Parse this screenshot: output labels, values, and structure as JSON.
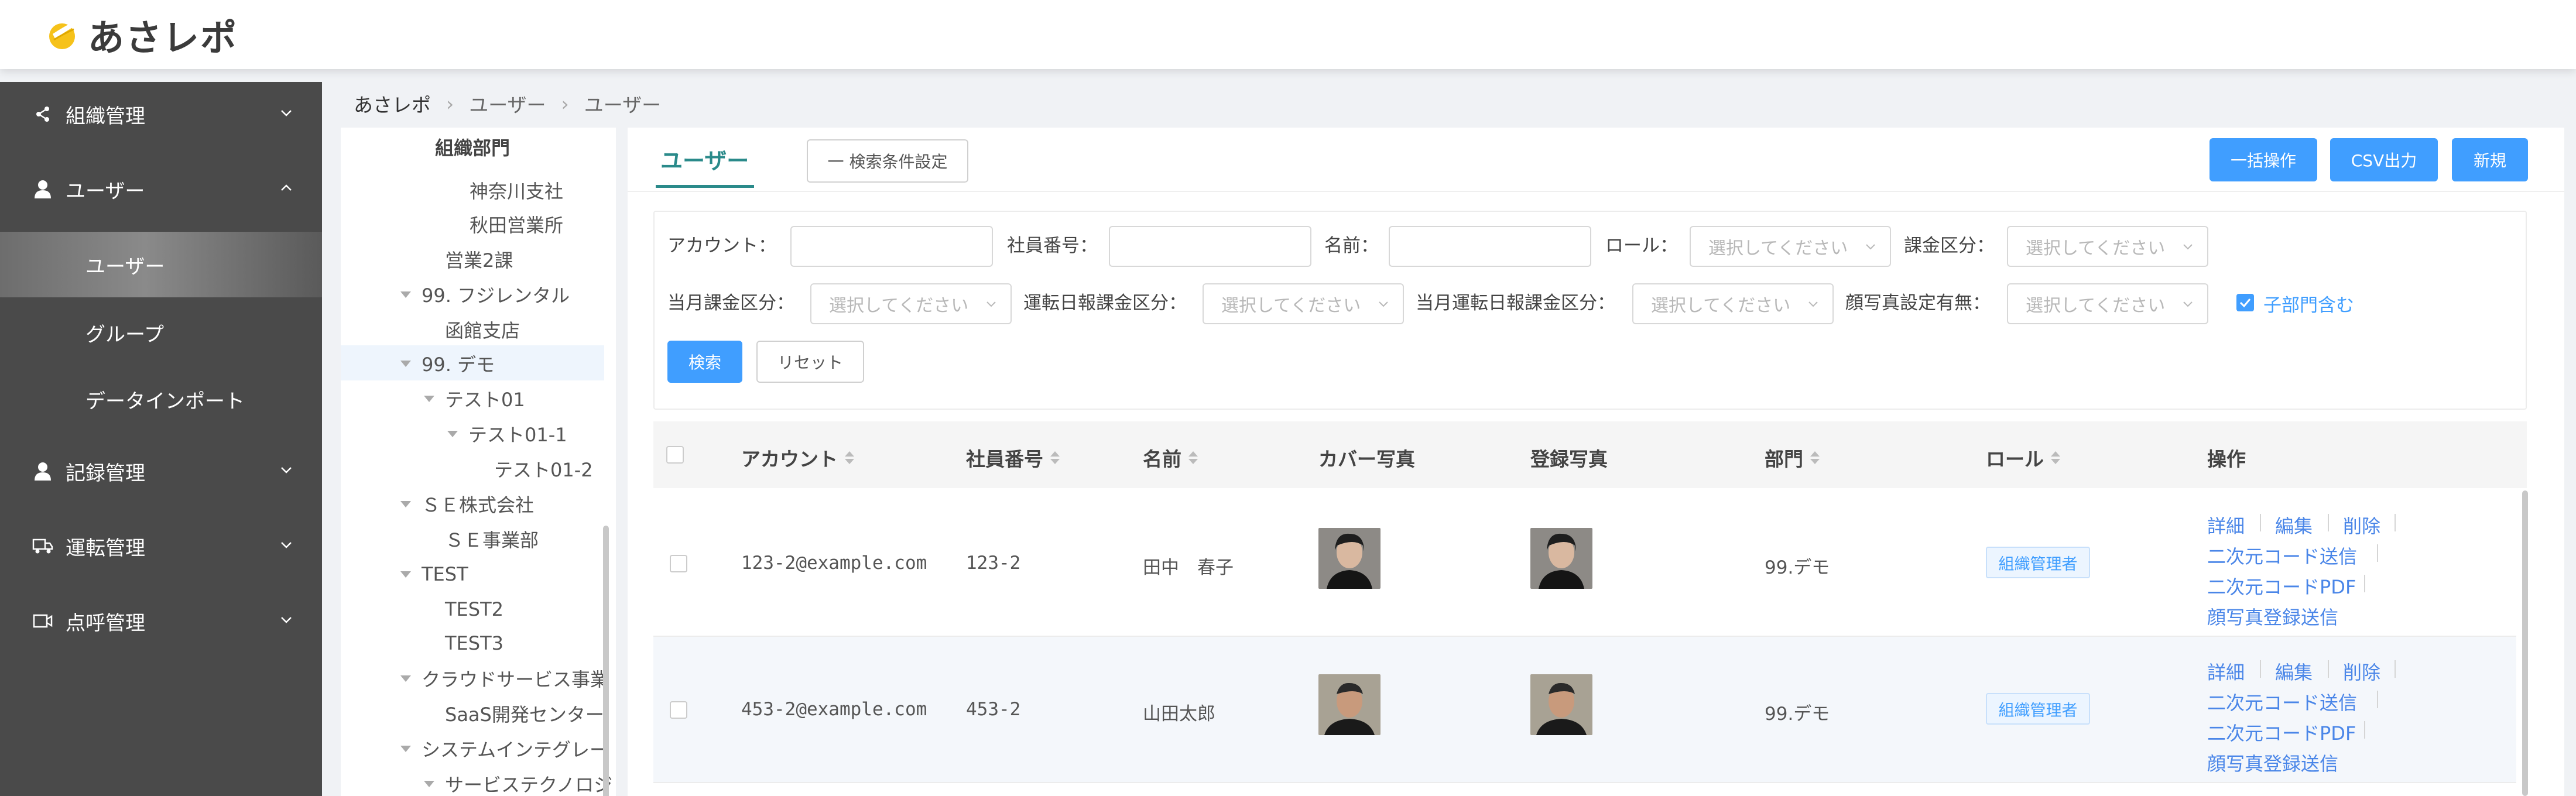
{
  "app": {
    "logo_text": "あさレポ"
  },
  "sidebar": {
    "groups": [
      {
        "label": "組織管理",
        "icon": "share-icon",
        "expanded": false
      },
      {
        "label": "ユーザー",
        "icon": "user-icon",
        "expanded": true
      },
      {
        "label": "記録管理",
        "icon": "user-icon",
        "expanded": false
      },
      {
        "label": "運転管理",
        "icon": "truck-icon",
        "expanded": false
      },
      {
        "label": "点呼管理",
        "icon": "camera-icon",
        "expanded": false
      }
    ],
    "sub_items": [
      {
        "label": "ユーザー",
        "active": true
      },
      {
        "label": "グループ",
        "active": false
      },
      {
        "label": "データインポート",
        "active": false
      }
    ]
  },
  "breadcrumb": [
    "あさレポ",
    "ユーザー",
    "ユーザー"
  ],
  "tree": {
    "title": "組織部門",
    "items": [
      {
        "label": "神奈川支社"
      },
      {
        "label": "秋田営業所"
      },
      {
        "label": "営業2課"
      },
      {
        "label": "99. フジレンタル"
      },
      {
        "label": "函館支店"
      },
      {
        "label": "99. デモ",
        "selected": true
      },
      {
        "label": "テスト01"
      },
      {
        "label": "テスト01-1"
      },
      {
        "label": "テスト01-2"
      },
      {
        "label": "ＳＥ株式会社"
      },
      {
        "label": "ＳＥ事業部"
      },
      {
        "label": "TEST"
      },
      {
        "label": "TEST2"
      },
      {
        "label": "TEST3"
      },
      {
        "label": "クラウドサービス事業"
      },
      {
        "label": "SaaS開発センター"
      },
      {
        "label": "システムインテグレー"
      },
      {
        "label": "サービステクノロジ"
      }
    ]
  },
  "tabs": {
    "active": "ユーザー"
  },
  "toolbar": {
    "search_settings": "一 検索条件設定",
    "bulk": "一括操作",
    "csv": "CSV出力",
    "new": "新規"
  },
  "filters": {
    "account": "アカウント：",
    "employee_no": "社員番号：",
    "name": "名前：",
    "role": "ロール：",
    "billing": "課金区分：",
    "month_billing": "当月課金区分：",
    "drive_report_billing": "運転日報課金区分：",
    "month_drive_report_billing": "当月運転日報課金区分：",
    "face_photo": "顔写真設定有無：",
    "include_sub": "子部門含む",
    "include_sub_checked": true,
    "select_placeholder": "選択してください",
    "search": "検索",
    "reset": "リセット"
  },
  "table": {
    "headers": {
      "account": "アカウント",
      "employee_no": "社員番号",
      "name": "名前",
      "cover": "カバー写真",
      "registered": "登録写真",
      "dept": "部門",
      "role": "ロール",
      "ops": "操作"
    },
    "rows": [
      {
        "account": "123-2@example.com",
        "employee_no": "123-2",
        "name": "田中　春子",
        "dept": "99.デモ",
        "role": "組織管理者"
      },
      {
        "account": "453-2@example.com",
        "employee_no": "453-2",
        "name": "山田太郎",
        "dept": "99.デモ",
        "role": "組織管理者"
      }
    ],
    "ops": {
      "detail": "詳細",
      "edit": "編集",
      "delete": "削除",
      "qr_send": "二次元コード送信",
      "qr_pdf": "二次元コードPDF",
      "face_send": "顔写真登録送信"
    }
  },
  "colors": {
    "accent": "#409eff",
    "tab_active": "#2a8a8a",
    "sidebar_bg": "#4a4a4a"
  }
}
